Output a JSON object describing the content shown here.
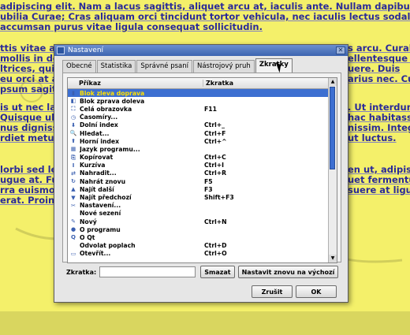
{
  "background_text": [
    "adipiscing elit. Nam a lacus sagittis, aliquet arcu at, iaculis ante. Nullam dapibus lacus",
    "ubilia Curae; Cras aliquam orci tincidunt tortor vehicula, nec iaculis lectus sodales. In pe",
    "accumsan purus vitae ligula consequat sollicitudin.",
    "ttis vitae a tell",
    "mollis in do",
    "ltrices, quis",
    "eu orci at a",
    "psum sagitti",
    "is ut nec lac",
    "Quisque ulla",
    "nus dignissim",
    "rdiet metus",
    "lorbi sed lec",
    "ugue at. Fusc",
    "rra euismod",
    "erat. Proin c",
    "s arcu. Curabi",
    "ellentesque c",
    "uere. Duis",
    "arius nec. Cur",
    ". Ut interdum",
    "hac habitasse",
    "nissim. Integ",
    "ut luctus.",
    "en ut, adipisc",
    "uet fermentum",
    "suere at ligula"
  ],
  "dialog": {
    "title": "Nastavení",
    "tabs": [
      "Obecné",
      "Statistika",
      "Správné psaní",
      "Nástrojový pruh",
      "Zkratky"
    ],
    "active_tab": "Zkratky",
    "columns": [
      "Příkaz",
      "Zkratka"
    ],
    "rows": [
      {
        "icon": "▮",
        "command": "Blok zleva doprava",
        "shortcut": "",
        "selected": true
      },
      {
        "icon": "◧",
        "command": "Blok zprava doleva",
        "shortcut": ""
      },
      {
        "icon": "⛶",
        "command": "Celá obrazovka",
        "shortcut": "F11"
      },
      {
        "icon": "◷",
        "command": "Časomíry...",
        "shortcut": ""
      },
      {
        "icon": "⬇",
        "command": "Dolní index",
        "shortcut": "Ctrl+_"
      },
      {
        "icon": "🔍",
        "command": "Hledat...",
        "shortcut": "Ctrl+F"
      },
      {
        "icon": "⬆",
        "command": "Horní index",
        "shortcut": "Ctrl+^"
      },
      {
        "icon": "▦",
        "command": "Jazyk programu...",
        "shortcut": ""
      },
      {
        "icon": "⎘",
        "command": "Kopírovat",
        "shortcut": "Ctrl+C"
      },
      {
        "icon": "I",
        "command": "Kurzíva",
        "shortcut": "Ctrl+I"
      },
      {
        "icon": "⇄",
        "command": "Nahradit...",
        "shortcut": "Ctrl+R"
      },
      {
        "icon": "↻",
        "command": "Nahrát znovu",
        "shortcut": "F5"
      },
      {
        "icon": "▲",
        "command": "Najít další",
        "shortcut": "F3"
      },
      {
        "icon": "▼",
        "command": "Najít předchozí",
        "shortcut": "Shift+F3"
      },
      {
        "icon": "✂",
        "command": "Nastavení...",
        "shortcut": ""
      },
      {
        "icon": "",
        "command": "Nové sezení",
        "shortcut": ""
      },
      {
        "icon": "✎",
        "command": "Nový",
        "shortcut": "Ctrl+N"
      },
      {
        "icon": "●",
        "command": "O programu",
        "shortcut": ""
      },
      {
        "icon": "Q",
        "command": "O Qt",
        "shortcut": ""
      },
      {
        "icon": "",
        "command": "Odvolat poplach",
        "shortcut": "Ctrl+D"
      },
      {
        "icon": "▭",
        "command": "Otevřít...",
        "shortcut": "Ctrl+O"
      }
    ],
    "shortcut_label": "Zkratka:",
    "shortcut_value": "",
    "clear_button": "Smazat",
    "reset_button": "Nastavit znovu na výchozí",
    "cancel_button": "Zrušit",
    "ok_button": "OK"
  }
}
